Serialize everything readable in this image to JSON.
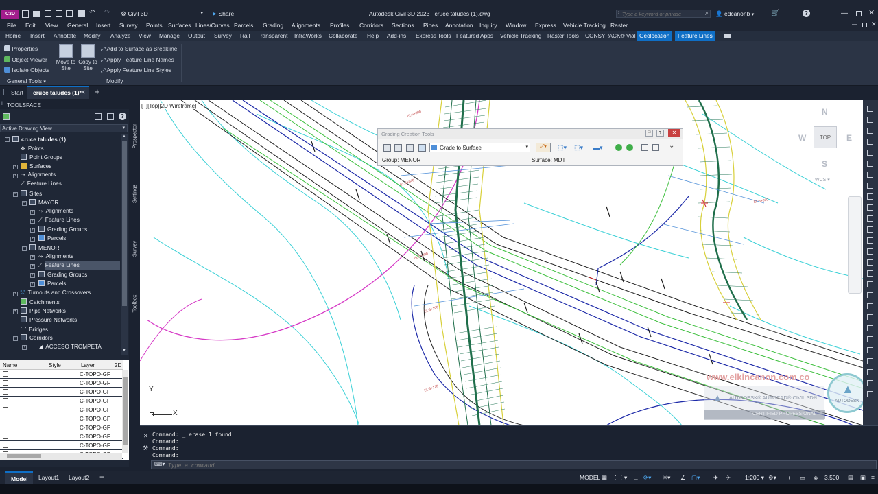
{
  "app": {
    "logo": "C3D",
    "workspace": "Civil 3D",
    "share_label": "Share",
    "title": "Autodesk Civil 3D 2023",
    "filename": "cruce taludes (1).dwg",
    "search_placeholder": "Type a keyword or phrase",
    "user": "edcanonb"
  },
  "menu": [
    "File",
    "Edit",
    "View",
    "General",
    "Insert",
    "Survey",
    "Points",
    "Surfaces",
    "Lines/Curves",
    "Parcels",
    "Grading",
    "Alignments",
    "Profiles",
    "Corridors",
    "Sections",
    "Pipes",
    "Annotation",
    "Inquiry",
    "Window",
    "Express",
    "Vehicle Tracking",
    "Raster"
  ],
  "ribbon_tabs": [
    "Home",
    "Insert",
    "Annotate",
    "Modify",
    "Analyze",
    "View",
    "Manage",
    "Output",
    "Survey",
    "Rail",
    "Transparent",
    "InfraWorks",
    "Collaborate",
    "Help",
    "Add-ins",
    "Express Tools",
    "Featured Apps",
    "Vehicle Tracking",
    "Raster Tools",
    "CONSYPACK® Vial",
    "Geolocation",
    "Feature Lines"
  ],
  "ribbon": {
    "general_tools": {
      "label": "General Tools",
      "items": [
        "Properties",
        "Object Viewer",
        "Isolate Objects"
      ]
    },
    "modify": {
      "label": "Modify",
      "move_to_site": "Move to Site",
      "copy_to_site": "Copy to Site",
      "items": [
        "Add to Surface as Breakline",
        "Apply Feature Line Names",
        "Apply Feature Line Styles"
      ]
    }
  },
  "doc_tabs": {
    "start": "Start",
    "active": "cruce taludes (1)*"
  },
  "toolspace": {
    "title": "TOOLSPACE",
    "view_mode": "Active Drawing View",
    "side_tabs": [
      "Prospector",
      "Settings",
      "Survey",
      "Toolbox"
    ],
    "tree": [
      {
        "label": "cruce taludes (1)",
        "level": 0
      },
      {
        "label": "Points",
        "level": 1
      },
      {
        "label": "Point Groups",
        "level": 1
      },
      {
        "label": "Surfaces",
        "level": 1
      },
      {
        "label": "Alignments",
        "level": 1
      },
      {
        "label": "Feature Lines",
        "level": 1
      },
      {
        "label": "Sites",
        "level": 1
      },
      {
        "label": "MAYOR",
        "level": 2
      },
      {
        "label": "Alignments",
        "level": 3
      },
      {
        "label": "Feature Lines",
        "level": 3
      },
      {
        "label": "Grading Groups",
        "level": 3
      },
      {
        "label": "Parcels",
        "level": 3
      },
      {
        "label": "MENOR",
        "level": 2
      },
      {
        "label": "Alignments",
        "level": 3
      },
      {
        "label": "Feature Lines",
        "level": 3
      },
      {
        "label": "Grading Groups",
        "level": 3
      },
      {
        "label": "Parcels",
        "level": 3
      },
      {
        "label": "Turnouts and Crossovers",
        "level": 1
      },
      {
        "label": "Catchments",
        "level": 1
      },
      {
        "label": "Pipe Networks",
        "level": 1
      },
      {
        "label": "Pressure Networks",
        "level": 1
      },
      {
        "label": "Bridges",
        "level": 1
      },
      {
        "label": "Corridors",
        "level": 1
      },
      {
        "label": "ACCESO TROMPETA",
        "level": 2
      }
    ],
    "grid": {
      "columns": [
        "Name",
        "Style",
        "Layer",
        "2D"
      ],
      "layers": [
        "C-TOPO-GF",
        "C-TOPO-GF",
        "C-TOPO-GF",
        "C-TOPO-GF",
        "C-TOPO-GF",
        "C-TOPO-GF",
        "C-TOPO-GF",
        "C-TOPO-GF",
        "C-TOPO-GF",
        "C-TOPO-GF"
      ]
    }
  },
  "viewport": {
    "label": "[−][Top][2D Wireframe]",
    "compass": {
      "n": "N",
      "s": "S",
      "e": "E",
      "w": "W",
      "top": "TOP",
      "wcs": "WCS"
    },
    "ucs": {
      "x": "X",
      "y": "Y"
    },
    "watermark": {
      "url": "www.elkincanon.com.co",
      "brand": "AUTODESK® AUTOCAD® CIVIL 3D®",
      "cert": "CERTIFIED PROFESSIONAL",
      "seal": "AUTODESK"
    }
  },
  "grading_panel": {
    "title": "Grading Creation Tools",
    "criteria": "Grade to Surface",
    "group": "Group: MENOR",
    "surface": "Surface: MDT"
  },
  "command": {
    "history": [
      "Command: _.erase 1 found",
      "Command:",
      "Command:",
      "Command:"
    ],
    "placeholder": "Type a command"
  },
  "status": {
    "layouts": [
      "Model",
      "Layout1",
      "Layout2"
    ],
    "model_label": "MODEL",
    "scale": "1:200",
    "value": "3.500"
  },
  "colors": {
    "accent": "#0f6fc6",
    "road_green": "#3dbf3d",
    "contour_cyan": "#3ad0d6",
    "magenta": "#d63ac6",
    "yellow": "#d8d03a",
    "dark_green": "#1f6e4a"
  }
}
